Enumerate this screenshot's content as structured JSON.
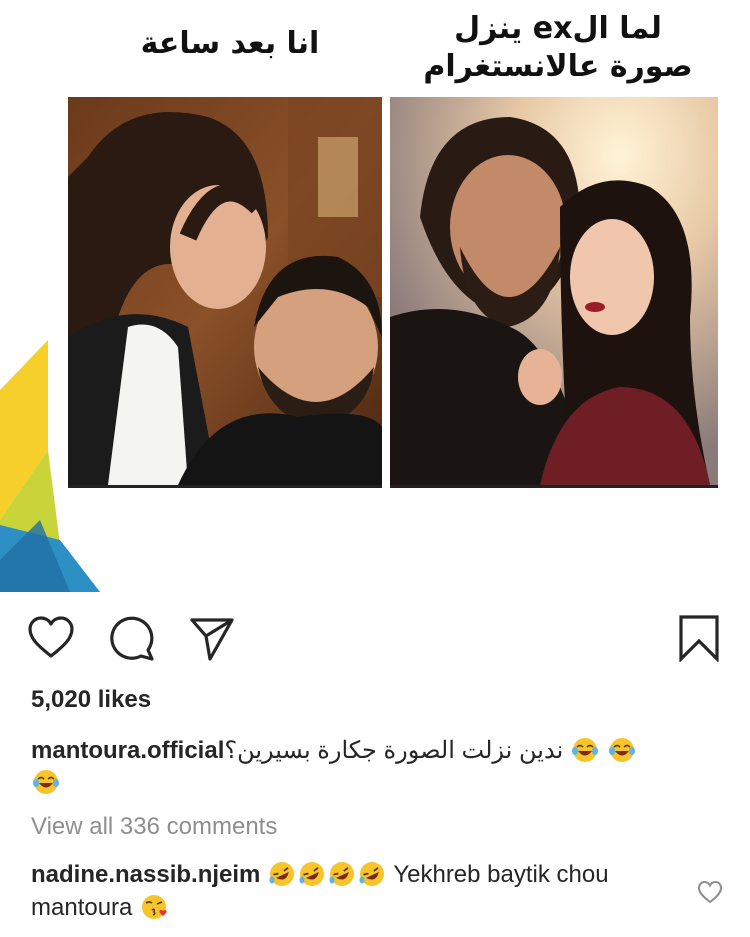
{
  "post": {
    "meme_caption_left": "انا  بعد ساعة",
    "meme_caption_right_line1": "لما الex ينزل",
    "meme_caption_right_line2": "صورة عالانستغرام",
    "likes": "5,020 likes",
    "caption_username": "mantoura.official",
    "caption_text": "ندين نزلت الصورة جكارة بسيرين؟",
    "view_all_comments": "View all 336 comments"
  },
  "comment": {
    "username": "nadine.nassib.njeim",
    "text": "Yekhreb baytik chou mantoura"
  },
  "icons": {
    "like": "heart-outline-icon",
    "comment": "speech-bubble-icon",
    "share": "paper-plane-icon",
    "save": "bookmark-icon",
    "caption_emoji": "face-with-tears-of-joy",
    "comment_emoji": "rolling-on-floor-laughing",
    "comment_end_emoji": "face-blowing-kiss"
  },
  "colors": {
    "text": "#262626",
    "muted": "#8e8e8e",
    "accent_yellow": "#f2c31b",
    "accent_blue": "#2d8fc4"
  }
}
